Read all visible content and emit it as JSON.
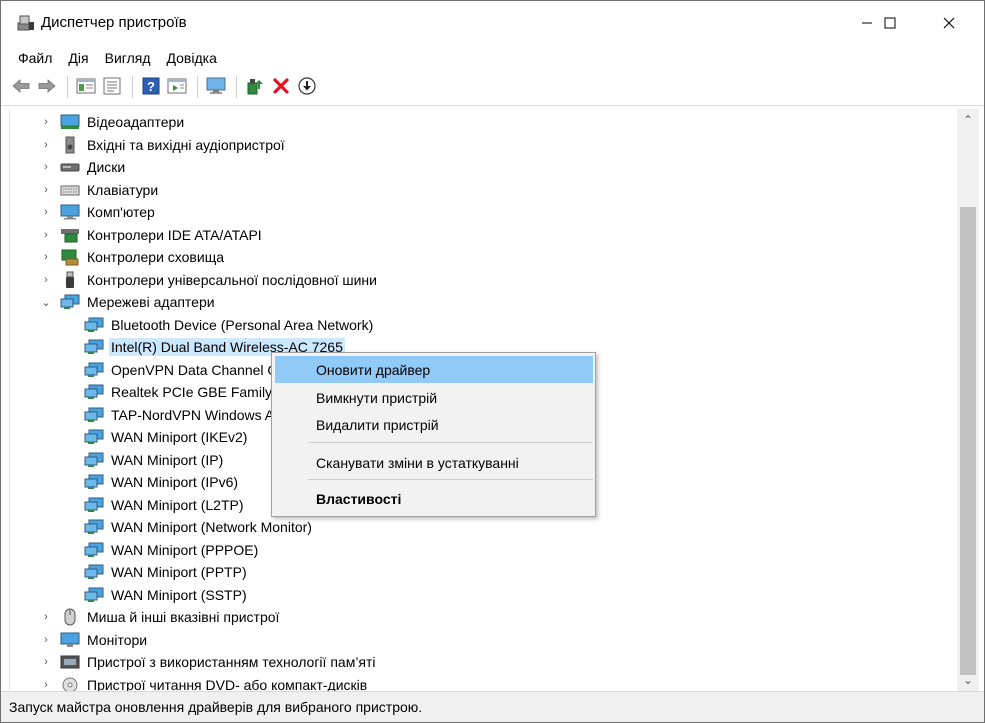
{
  "window": {
    "title": "Диспетчер пристроїв",
    "icon": "device-manager-icon"
  },
  "menu": [
    "Файл",
    "Дія",
    "Вигляд",
    "Довідка"
  ],
  "toolbar": {
    "buttons": [
      "back-icon",
      "forward-icon",
      "show-hide-console-tree-icon",
      "properties-icon",
      "help-icon",
      "action-pane-icon",
      "computer-monitor-icon",
      "update-driver-icon",
      "uninstall-icon",
      "download-icon"
    ]
  },
  "tree": {
    "categories_top": [
      {
        "label": "Відеоадаптери",
        "icon": "display-adapter-icon",
        "expanded": false
      },
      {
        "label": "Вхідні та вихідні аудіопристрої",
        "icon": "speaker-icon",
        "expanded": false
      },
      {
        "label": "Диски",
        "icon": "disk-drive-icon",
        "expanded": false
      },
      {
        "label": "Клавіатури",
        "icon": "keyboard-icon",
        "expanded": false
      },
      {
        "label": "Комп'ютер",
        "icon": "computer-icon",
        "expanded": false
      },
      {
        "label": "Контролери IDE ATA/ATAPI",
        "icon": "ide-controller-icon",
        "expanded": false
      },
      {
        "label": "Контролери сховища",
        "icon": "storage-controller-icon",
        "expanded": false
      },
      {
        "label": "Контролери універсальної послідовної шини",
        "icon": "usb-icon",
        "expanded": false
      },
      {
        "label": "Мережеві адаптери",
        "icon": "network-adapter-icon",
        "expanded": true
      }
    ],
    "network_adapters": [
      {
        "label": "Bluetooth Device (Personal Area Network)",
        "selected": false
      },
      {
        "label": "Intel(R) Dual Band Wireless-AC 7265",
        "selected": true
      },
      {
        "label": "OpenVPN Data Channel Offload",
        "selected": false
      },
      {
        "label": "Realtek PCIe GBE Family Controller",
        "selected": false
      },
      {
        "label": "TAP-NordVPN Windows Adapter V9",
        "selected": false
      },
      {
        "label": "WAN Miniport (IKEv2)",
        "selected": false
      },
      {
        "label": "WAN Miniport (IP)",
        "selected": false
      },
      {
        "label": "WAN Miniport (IPv6)",
        "selected": false
      },
      {
        "label": "WAN Miniport (L2TP)",
        "selected": false
      },
      {
        "label": "WAN Miniport (Network Monitor)",
        "selected": false
      },
      {
        "label": "WAN Miniport (PPPOE)",
        "selected": false
      },
      {
        "label": "WAN Miniport (PPTP)",
        "selected": false
      },
      {
        "label": "WAN Miniport (SSTP)",
        "selected": false
      }
    ],
    "categories_bottom": [
      {
        "label": "Миша й інші вказівні пристрої",
        "icon": "mouse-icon",
        "expanded": false
      },
      {
        "label": "Монітори",
        "icon": "monitor-icon",
        "expanded": false
      },
      {
        "label": "Пристрої з використанням технології пам’яті",
        "icon": "memory-technology-icon",
        "expanded": false
      },
      {
        "label": "Пристрої читання DVD- або компакт-дисків",
        "icon": "dvd-drive-icon",
        "expanded": false
      }
    ]
  },
  "context_menu": {
    "items": [
      {
        "label": "Оновити драйвер",
        "highlighted": true,
        "bold": false
      },
      {
        "label": "Вимкнути пристрій",
        "highlighted": false,
        "bold": false
      },
      {
        "label": "Видалити пристрій",
        "highlighted": false,
        "bold": false
      },
      {
        "label": "Сканувати зміни в устаткуванні",
        "highlighted": false,
        "bold": false
      },
      {
        "label": "Властивості",
        "highlighted": false,
        "bold": true
      }
    ]
  },
  "status": {
    "text": "Запуск майстра оновлення драйверів для вибраного пристрою."
  },
  "colors": {
    "selection": "#cce8ff",
    "menu_highlight": "#91c9f7",
    "uninstall_red": "#e81123",
    "update_green": "#2e8b3d"
  }
}
